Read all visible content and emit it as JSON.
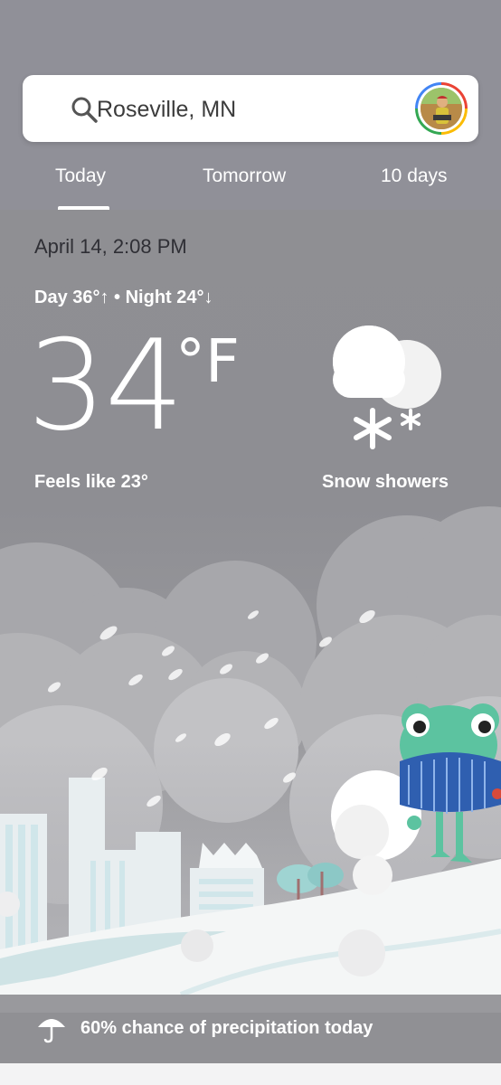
{
  "search": {
    "location": "Roseville, MN",
    "icon": "search-icon"
  },
  "tabs": [
    {
      "label": "Today",
      "selected": true
    },
    {
      "label": "Tomorrow",
      "selected": false
    },
    {
      "label": "10 days",
      "selected": false
    }
  ],
  "weather": {
    "datetime": "April 14, 2:08 PM",
    "day_night": "Day 36°↑ • Night 24°↓",
    "temperature": "34",
    "unit": "°F",
    "feels_like": "Feels like 23°",
    "condition": "Snow showers",
    "condition_icon": "snow-showers-icon"
  },
  "footer": {
    "precipitation": "60% chance of precipitation today",
    "icon": "umbrella-icon"
  },
  "colors": {
    "header_bg": "#909098",
    "card_bg": "#ffffff",
    "text_white": "#ffffff",
    "date_text": "#2f2f35"
  }
}
